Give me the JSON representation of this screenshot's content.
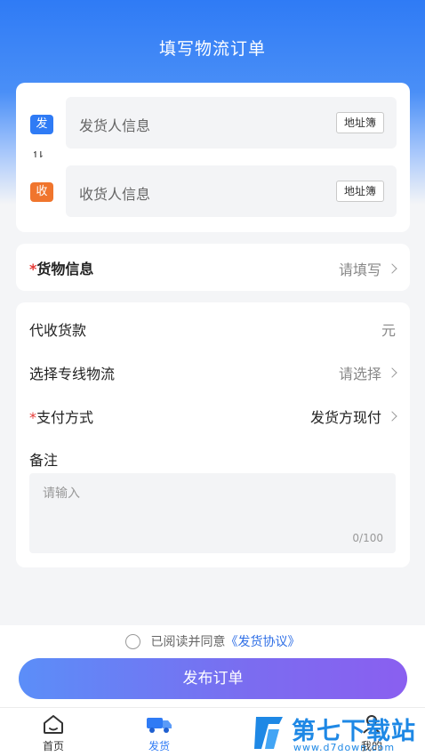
{
  "header": {
    "title": "填写物流订单"
  },
  "address": {
    "sender_badge": "发",
    "receiver_badge": "收",
    "swap_symbol": "↿⇂",
    "sender_placeholder": "发货人信息",
    "receiver_placeholder": "收货人信息",
    "address_book_label": "地址簿"
  },
  "goods": {
    "required_mark": "*",
    "label": "货物信息",
    "value": "请填写"
  },
  "details": {
    "cod_label": "代收货款",
    "cod_unit": "元",
    "line_label": "选择专线物流",
    "line_value": "请选择",
    "payment_required_mark": "*",
    "payment_label": "支付方式",
    "payment_value": "发货方现付",
    "remark_label": "备注",
    "remark_placeholder": "请输入",
    "remark_count": "0/100"
  },
  "agreement": {
    "text": "已阅读并同意",
    "link": "《发货协议》"
  },
  "publish_button": "发布订单",
  "tabbar": {
    "items": [
      {
        "label": "首页",
        "icon": "home-icon",
        "active": false
      },
      {
        "label": "发货",
        "icon": "truck-icon",
        "active": true
      },
      {
        "label": "我的",
        "icon": "user-icon",
        "active": false
      }
    ]
  },
  "watermark": {
    "brand": "第七下载站",
    "url": "www.d7down.com"
  },
  "colors": {
    "primary": "#2f7bf5",
    "sender_badge": "#2f7bf5",
    "receiver_badge": "#f0752d",
    "required": "#e53935",
    "button_start": "#5b8ef8",
    "button_end": "#8a5ff0"
  }
}
